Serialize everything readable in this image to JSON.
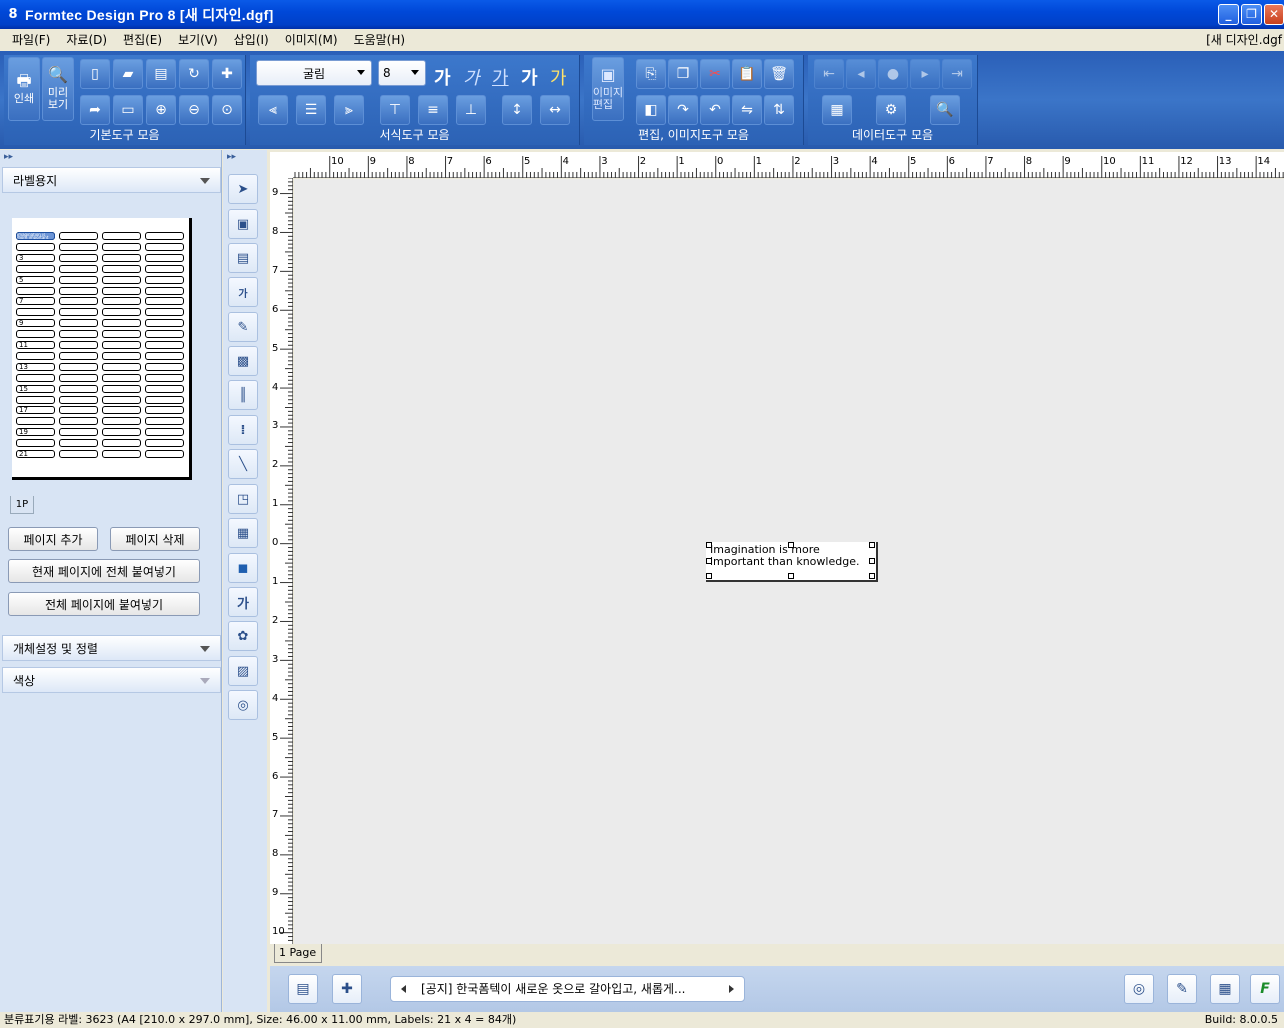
{
  "window": {
    "icon_glyph": "8",
    "title": "Formtec Design Pro 8 [새 디자인.dgf]",
    "controls": {
      "minimize": "_",
      "restore": "❐",
      "close": "✕"
    }
  },
  "menu": {
    "items": [
      "파일(F)",
      "자료(D)",
      "편집(E)",
      "보기(V)",
      "삽입(I)",
      "이미지(M)",
      "도움말(H)"
    ],
    "document": "[새 디자인.dgf"
  },
  "toolbar": {
    "groups": {
      "basic": "기본도구 모음",
      "format": "서식도구 모음",
      "edit_image": "편집, 이미지도구 모음",
      "data": "데이터도구 모음"
    },
    "print_label": "인쇄",
    "preview_label": "미리\n보기",
    "image_edit_label": "이미지\n편집",
    "font_name": "굴림",
    "font_size": "8",
    "text_styles": [
      "가",
      "가",
      "가",
      "가",
      "가"
    ]
  },
  "left_panel": {
    "label_paper_header": "라벨용지",
    "row_numbers": [
      "3",
      "5",
      "7",
      "9",
      "11",
      "13",
      "15",
      "17",
      "19",
      "21"
    ],
    "first_cell_text": "Imagination is more important than knowledge.",
    "page_tab": "1P",
    "buttons": {
      "add_page": "페이지 추가",
      "delete_page": "페이지 삭제",
      "paste_all_current": "현재 페이지에 전체 붙여넣기",
      "paste_all_pages": "전체 페이지에 붙여넣기"
    },
    "object_settings_header": "개체설정 및 정렬",
    "color_header": "색상"
  },
  "rulers": {
    "top_labels": [
      "10",
      "9",
      "8",
      "7",
      "6",
      "5",
      "4",
      "3",
      "2",
      "1",
      "0",
      "1",
      "2",
      "3",
      "4",
      "5",
      "6",
      "7",
      "8",
      "9",
      "10",
      "11",
      "12",
      "13",
      "14"
    ],
    "left_labels": [
      "9",
      "8",
      "7",
      "6",
      "5",
      "4",
      "3",
      "2",
      "1",
      "0",
      "1",
      "2",
      "3",
      "4",
      "5",
      "6",
      "7",
      "8",
      "9",
      "10"
    ]
  },
  "canvas": {
    "label_text_line1": "Imagination is more",
    "label_text_line2": "important than knowledge.",
    "page_tab": "1 Page"
  },
  "bottom": {
    "notice": "[공지] 한국폼텍이 새로운 옷으로 갈아입고, 새롭게..."
  },
  "status": {
    "left": "분류표기용 라벨: 3623 (A4 [210.0 x 297.0 mm], Size: 46.00 x 11.00 mm, Labels: 21 x 4 = 84개)",
    "build": "Build: 8.0.0.5"
  }
}
